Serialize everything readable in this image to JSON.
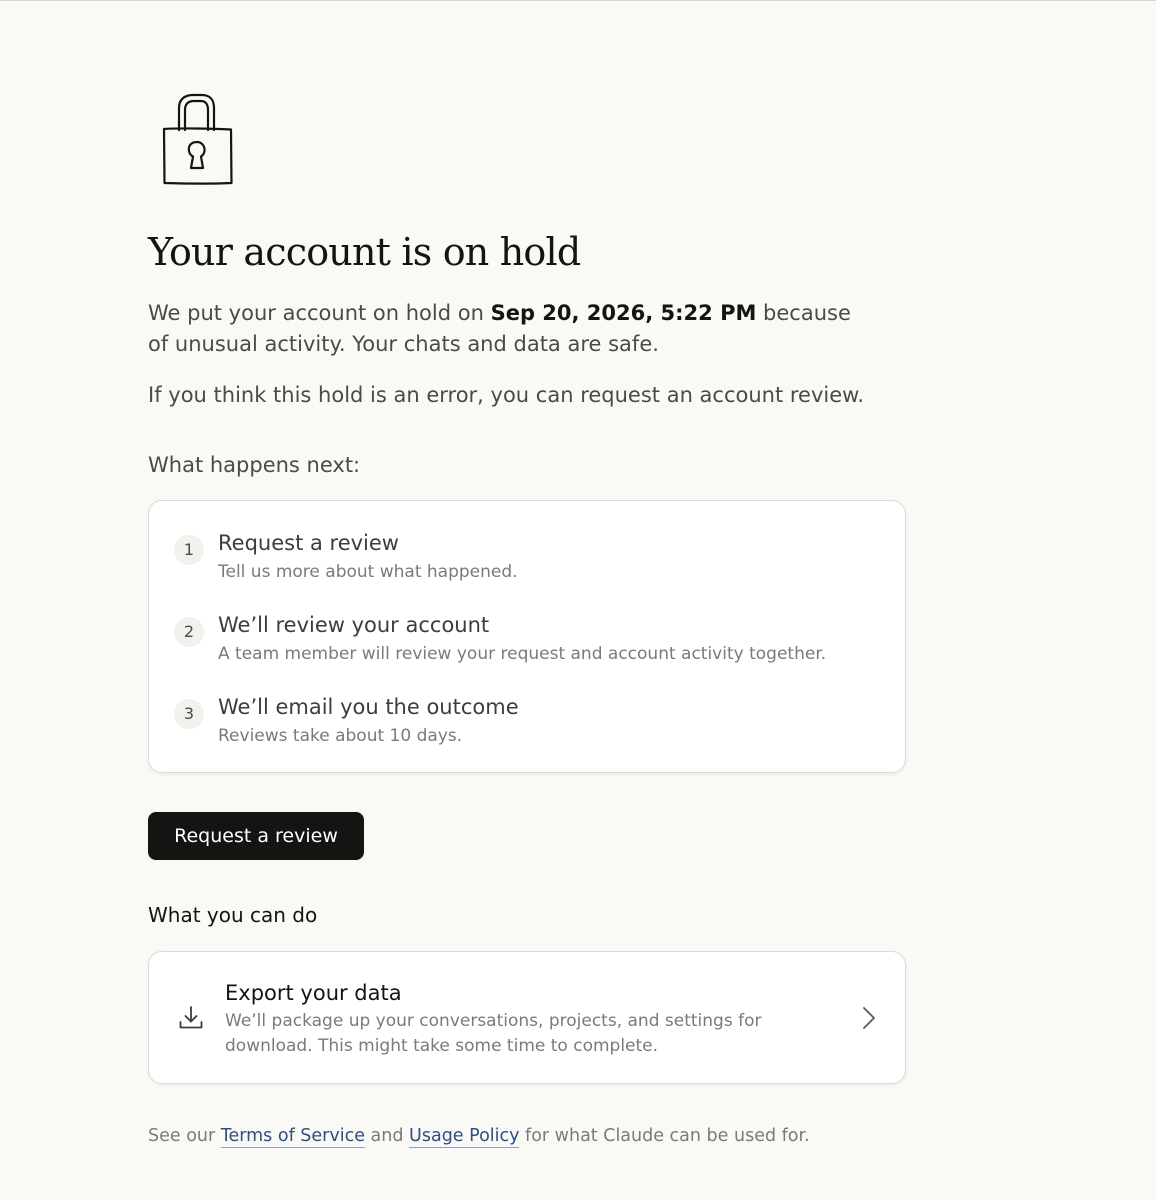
{
  "page": {
    "title": "Your account is on hold",
    "intro_before": "We put your account on hold on ",
    "hold_date": "Sep 20, 2026, 5:22 PM",
    "intro_after": " because of unusual activity. Your chats and data are safe.",
    "error_note": "If you think this hold is an error, you can request an account review.",
    "next_label": "What happens next:"
  },
  "steps": [
    {
      "num": "1",
      "title": "Request a review",
      "desc": "Tell us more about what happened."
    },
    {
      "num": "2",
      "title": "We’ll review your account",
      "desc": "A team member will review your request and account activity together."
    },
    {
      "num": "3",
      "title": "We’ll email you the outcome",
      "desc": "Reviews take about 10 days."
    }
  ],
  "actions": {
    "request_review_label": "Request a review"
  },
  "can_do": {
    "heading": "What you can do",
    "export_title": "Export your data",
    "export_desc": "We’ll package up your conversations, projects, and settings for download. This might take some time to complete."
  },
  "footer": {
    "prefix": "See our ",
    "tos_label": "Terms of Service",
    "middle": " and ",
    "usage_label": "Usage Policy",
    "suffix": " for what Claude can be used for."
  },
  "icons": {
    "lock": "lock-icon",
    "download": "download-icon",
    "chevron": "chevron-right-icon"
  },
  "colors": {
    "background": "#faf9f6",
    "button": "#141413",
    "link": "#2c4f80"
  }
}
